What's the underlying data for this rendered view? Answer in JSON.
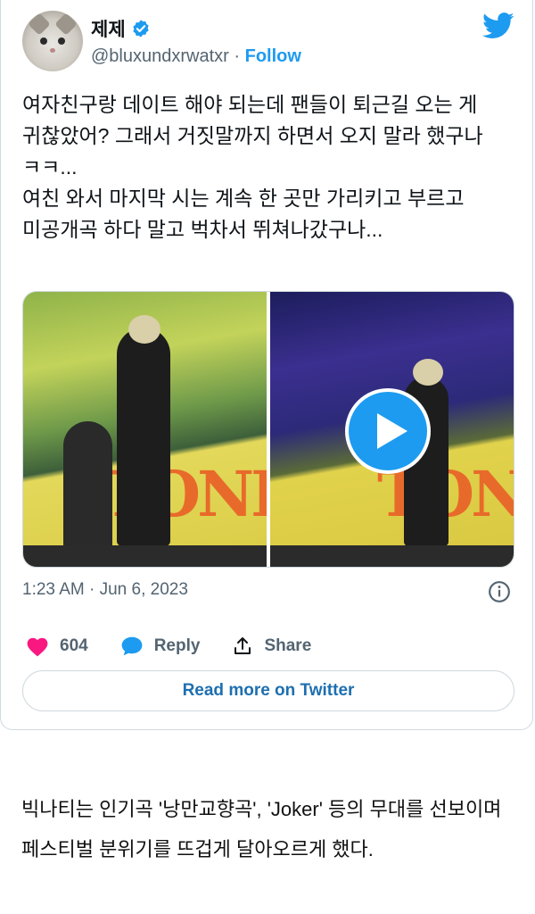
{
  "tweet": {
    "display_name": "제제",
    "handle": "@bluxundxrwatxr",
    "separator": "·",
    "follow_label": "Follow",
    "text": "여자친구랑 데이트 해야 되는데 팬들이 퇴근길 오는 게 귀찮았어? 그래서 거짓말까지 하면서 오지 말라 했구나 ㅋㅋ...\n여친 와서 마지막 시는 계속 한 곳만 가리키고 부르고\n미공개곡 하다 말고 벅차서 뛰쳐나갔구나...",
    "timestamp": "1:23 AM · Jun 6, 2023",
    "likes": "604",
    "reply_label": "Reply",
    "share_label": "Share",
    "read_more_label": "Read more on Twitter",
    "media": {
      "left_banner": "TONE",
      "right_banner": "TONE",
      "has_video": true
    }
  },
  "colors": {
    "brand": "#1d9bf0",
    "like": "#f91880",
    "muted": "#536471",
    "border": "#cfd9de"
  },
  "article": {
    "text": "빅나티는 인기곡 '낭만교향곡', 'Joker' 등의 무대를 선보이며 페스티벌 분위기를 뜨겁게 달아오르게 했다."
  }
}
